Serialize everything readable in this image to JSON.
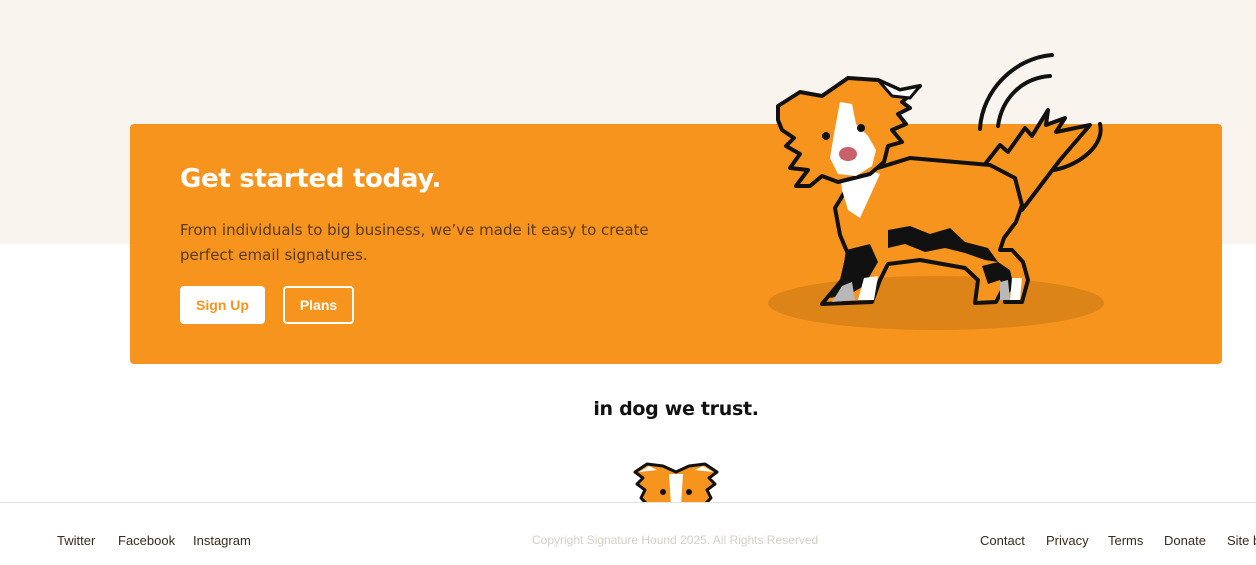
{
  "cta": {
    "title": "Get started today.",
    "description": "From individuals to big business, we’ve made it easy to create perfect email signatures.",
    "signup_label": "Sign Up",
    "plans_label": "Plans"
  },
  "tagline": "in dog we trust.",
  "footer": {
    "social": [
      "Twitter",
      "Facebook",
      "Instagram"
    ],
    "copyright": "Copyright Signature Hound 2025. All Rights Reserved",
    "links": [
      "Contact",
      "Privacy",
      "Terms",
      "Donate",
      "Site b"
    ]
  },
  "colors": {
    "page_bg": "#f9f5ee",
    "accent": "#f6941e",
    "text_dark": "#5a3a1c",
    "copyright": "#d5cfc5"
  },
  "icons": [
    "dog-illustration",
    "dog-peek-illustration"
  ]
}
